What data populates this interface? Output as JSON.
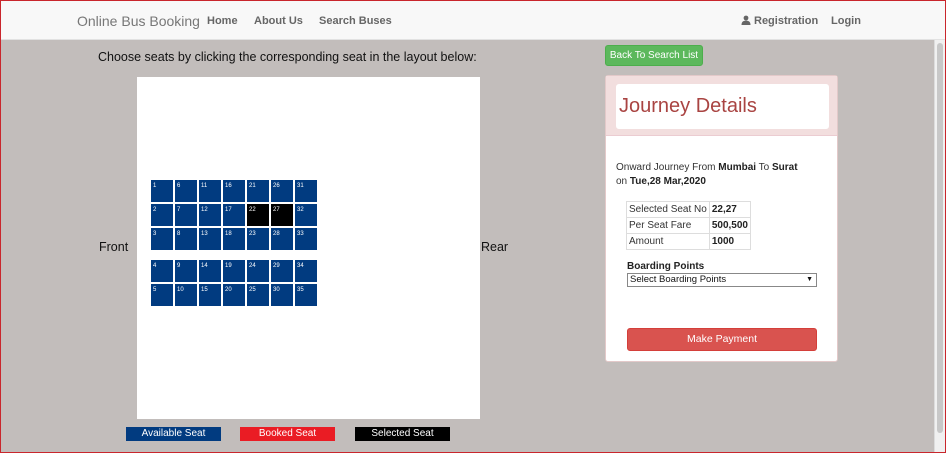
{
  "navbar": {
    "brand": "Online Bus Booking",
    "links": [
      "Home",
      "About Us",
      "Search Buses"
    ],
    "registration": "Registration",
    "login": "Login"
  },
  "main": {
    "instruction": "Choose seats by clicking the corresponding seat in the layout below:",
    "front_label": "Front",
    "rear_label": "Rear",
    "seat_rows_top": [
      [
        {
          "n": "1",
          "state": "available"
        },
        {
          "n": "6",
          "state": "available"
        },
        {
          "n": "11",
          "state": "available"
        },
        {
          "n": "16",
          "state": "available"
        },
        {
          "n": "21",
          "state": "available"
        },
        {
          "n": "26",
          "state": "available"
        },
        {
          "n": "31",
          "state": "available"
        }
      ],
      [
        {
          "n": "2",
          "state": "available"
        },
        {
          "n": "7",
          "state": "available"
        },
        {
          "n": "12",
          "state": "available"
        },
        {
          "n": "17",
          "state": "available"
        },
        {
          "n": "22",
          "state": "selected"
        },
        {
          "n": "27",
          "state": "selected"
        },
        {
          "n": "32",
          "state": "available"
        }
      ],
      [
        {
          "n": "3",
          "state": "available"
        },
        {
          "n": "8",
          "state": "available"
        },
        {
          "n": "13",
          "state": "available"
        },
        {
          "n": "18",
          "state": "available"
        },
        {
          "n": "23",
          "state": "available"
        },
        {
          "n": "28",
          "state": "available"
        },
        {
          "n": "33",
          "state": "available"
        }
      ]
    ],
    "seat_rows_bottom": [
      [
        {
          "n": "4",
          "state": "available"
        },
        {
          "n": "9",
          "state": "available"
        },
        {
          "n": "14",
          "state": "available"
        },
        {
          "n": "19",
          "state": "available"
        },
        {
          "n": "24",
          "state": "available"
        },
        {
          "n": "29",
          "state": "available"
        },
        {
          "n": "34",
          "state": "available"
        }
      ],
      [
        {
          "n": "5",
          "state": "available"
        },
        {
          "n": "10",
          "state": "available"
        },
        {
          "n": "15",
          "state": "available"
        },
        {
          "n": "20",
          "state": "available"
        },
        {
          "n": "25",
          "state": "available"
        },
        {
          "n": "30",
          "state": "available"
        },
        {
          "n": "35",
          "state": "available"
        }
      ]
    ],
    "legend": {
      "available": "Available Seat",
      "booked": "Booked Seat",
      "selected": "Selected Seat"
    }
  },
  "sidebar": {
    "back_button": "Back To Search List",
    "title": "Journey Details",
    "journey_prefix": "Onward Journey From",
    "from": "Mumbai",
    "to_word": "To",
    "to": "Surat",
    "on_word": "on",
    "date": "Tue,28 Mar,2020",
    "table": {
      "selected_seat_label": "Selected Seat No",
      "selected_seat_value": "22,27",
      "fare_label": "Per Seat Fare",
      "fare_value": "500,500",
      "amount_label": "Amount",
      "amount_value": "1000"
    },
    "boarding_label": "Boarding Points",
    "boarding_select": "Select Boarding Points",
    "pay_button": "Make Payment"
  },
  "colors": {
    "available": "#013b80",
    "booked": "#ea1c24",
    "selected": "#000000",
    "pay": "#d9534f",
    "back": "#5cb85c",
    "title": "#a94442"
  }
}
